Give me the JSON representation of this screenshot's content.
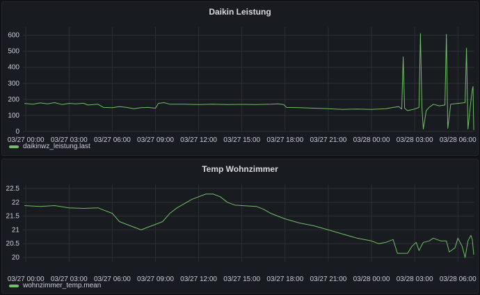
{
  "theme": {
    "background": "#111217",
    "panel": "#181b1f",
    "grid": "#2c3036",
    "text": "#ccccdc"
  },
  "chart_data": [
    {
      "type": "line",
      "title": "Daikin Leistung",
      "x_ticks": [
        "03/27 00:00",
        "03/27 03:00",
        "03/27 06:00",
        "03/27 09:00",
        "03/27 12:00",
        "03/27 15:00",
        "03/27 18:00",
        "03/27 21:00",
        "03/28 00:00",
        "03/28 03:00",
        "03/28 06:00"
      ],
      "x_range_hours": [
        -0.2,
        31.1
      ],
      "y_ticks": [
        "0",
        "100",
        "200",
        "300",
        "400",
        "500",
        "600"
      ],
      "ylim": [
        0,
        650
      ],
      "grid": true,
      "legend": "bottom-left",
      "series": [
        {
          "name": "daikinwz_leistung.last",
          "color": "#73bf69",
          "points": [
            [
              -0.1,
              175
            ],
            [
              0.5,
              170
            ],
            [
              1,
              178
            ],
            [
              1.5,
              172
            ],
            [
              2,
              180
            ],
            [
              2.5,
              168
            ],
            [
              3,
              175
            ],
            [
              3.5,
              172
            ],
            [
              4,
              176
            ],
            [
              4.3,
              165
            ],
            [
              5,
              170
            ],
            [
              5.4,
              150
            ],
            [
              6,
              148
            ],
            [
              6.5,
              155
            ],
            [
              7,
              150
            ],
            [
              7.5,
              142
            ],
            [
              8,
              148
            ],
            [
              8.5,
              150
            ],
            [
              9,
              145
            ],
            [
              9.2,
              175
            ],
            [
              9.6,
              180
            ],
            [
              10,
              170
            ],
            [
              11,
              170
            ],
            [
              12,
              168
            ],
            [
              13,
              170
            ],
            [
              14,
              168
            ],
            [
              15,
              169
            ],
            [
              16,
              168
            ],
            [
              17,
              170
            ],
            [
              17.5,
              172
            ],
            [
              17.9,
              168
            ],
            [
              18.1,
              150
            ],
            [
              19,
              148
            ],
            [
              20,
              145
            ],
            [
              21,
              142
            ],
            [
              22,
              138
            ],
            [
              23,
              140
            ],
            [
              24,
              138
            ],
            [
              25,
              142
            ],
            [
              25.5,
              150
            ],
            [
              25.9,
              155
            ],
            [
              26.1,
              140
            ],
            [
              26.2,
              465
            ],
            [
              26.3,
              145
            ],
            [
              26.5,
              130
            ],
            [
              27,
              140
            ],
            [
              27.3,
              150
            ],
            [
              27.4,
              610
            ],
            [
              27.5,
              150
            ],
            [
              27.6,
              15
            ],
            [
              27.8,
              130
            ],
            [
              28,
              150
            ],
            [
              28.3,
              170
            ],
            [
              28.7,
              160
            ],
            [
              29.1,
              165
            ],
            [
              29.2,
              605
            ],
            [
              29.3,
              20
            ],
            [
              29.5,
              170
            ],
            [
              30,
              175
            ],
            [
              30.5,
              180
            ],
            [
              30.6,
              520
            ],
            [
              30.7,
              15
            ],
            [
              30.9,
              190
            ],
            [
              31.0,
              260
            ],
            [
              31.05,
              280
            ],
            [
              31.1,
              10
            ]
          ]
        }
      ]
    },
    {
      "type": "line",
      "title": "Temp Wohnzimmer",
      "x_ticks": [
        "03/27 00:00",
        "03/27 03:00",
        "03/27 06:00",
        "03/27 09:00",
        "03/27 12:00",
        "03/27 15:00",
        "03/27 18:00",
        "03/27 21:00",
        "03/28 00:00",
        "03/28 03:00",
        "03/28 06:00"
      ],
      "x_range_hours": [
        -0.2,
        31.1
      ],
      "y_ticks": [
        "20",
        "20.5",
        "21",
        "21.5",
        "22",
        "22.5"
      ],
      "ylim": [
        19.85,
        22.65
      ],
      "grid": true,
      "legend": "bottom-left",
      "series": [
        {
          "name": "wohnzimmer_temp.mean",
          "color": "#73bf69",
          "points": [
            [
              -0.1,
              21.88
            ],
            [
              1,
              21.85
            ],
            [
              2,
              21.88
            ],
            [
              3,
              21.8
            ],
            [
              4,
              21.78
            ],
            [
              5,
              21.8
            ],
            [
              5.5,
              21.7
            ],
            [
              6,
              21.6
            ],
            [
              6.5,
              21.3
            ],
            [
              7,
              21.2
            ],
            [
              7.5,
              21.1
            ],
            [
              8,
              21.0
            ],
            [
              8.5,
              21.1
            ],
            [
              9,
              21.2
            ],
            [
              9.5,
              21.3
            ],
            [
              10,
              21.6
            ],
            [
              10.5,
              21.8
            ],
            [
              11,
              21.95
            ],
            [
              11.5,
              22.1
            ],
            [
              12,
              22.2
            ],
            [
              12.5,
              22.3
            ],
            [
              13,
              22.3
            ],
            [
              13.5,
              22.2
            ],
            [
              14,
              22.0
            ],
            [
              14.5,
              21.9
            ],
            [
              15,
              21.88
            ],
            [
              16,
              21.85
            ],
            [
              16.5,
              21.75
            ],
            [
              17,
              21.6
            ],
            [
              17.5,
              21.5
            ],
            [
              18,
              21.4
            ],
            [
              19,
              21.25
            ],
            [
              20,
              21.15
            ],
            [
              21,
              21.0
            ],
            [
              22,
              20.85
            ],
            [
              23,
              20.7
            ],
            [
              24,
              20.6
            ],
            [
              24.5,
              20.5
            ],
            [
              25,
              20.55
            ],
            [
              25.5,
              20.65
            ],
            [
              25.8,
              20.15
            ],
            [
              26.5,
              20.15
            ],
            [
              26.8,
              20.4
            ],
            [
              27.1,
              20.55
            ],
            [
              27.3,
              20.25
            ],
            [
              27.6,
              20.55
            ],
            [
              28,
              20.6
            ],
            [
              28.3,
              20.7
            ],
            [
              28.8,
              20.6
            ],
            [
              29.2,
              20.6
            ],
            [
              29.4,
              20.2
            ],
            [
              29.8,
              20.35
            ],
            [
              30,
              20.7
            ],
            [
              30.3,
              20.4
            ],
            [
              30.5,
              20.0
            ],
            [
              30.7,
              20.6
            ],
            [
              30.9,
              20.8
            ],
            [
              31.0,
              20.65
            ],
            [
              31.1,
              20.1
            ]
          ]
        }
      ]
    }
  ]
}
